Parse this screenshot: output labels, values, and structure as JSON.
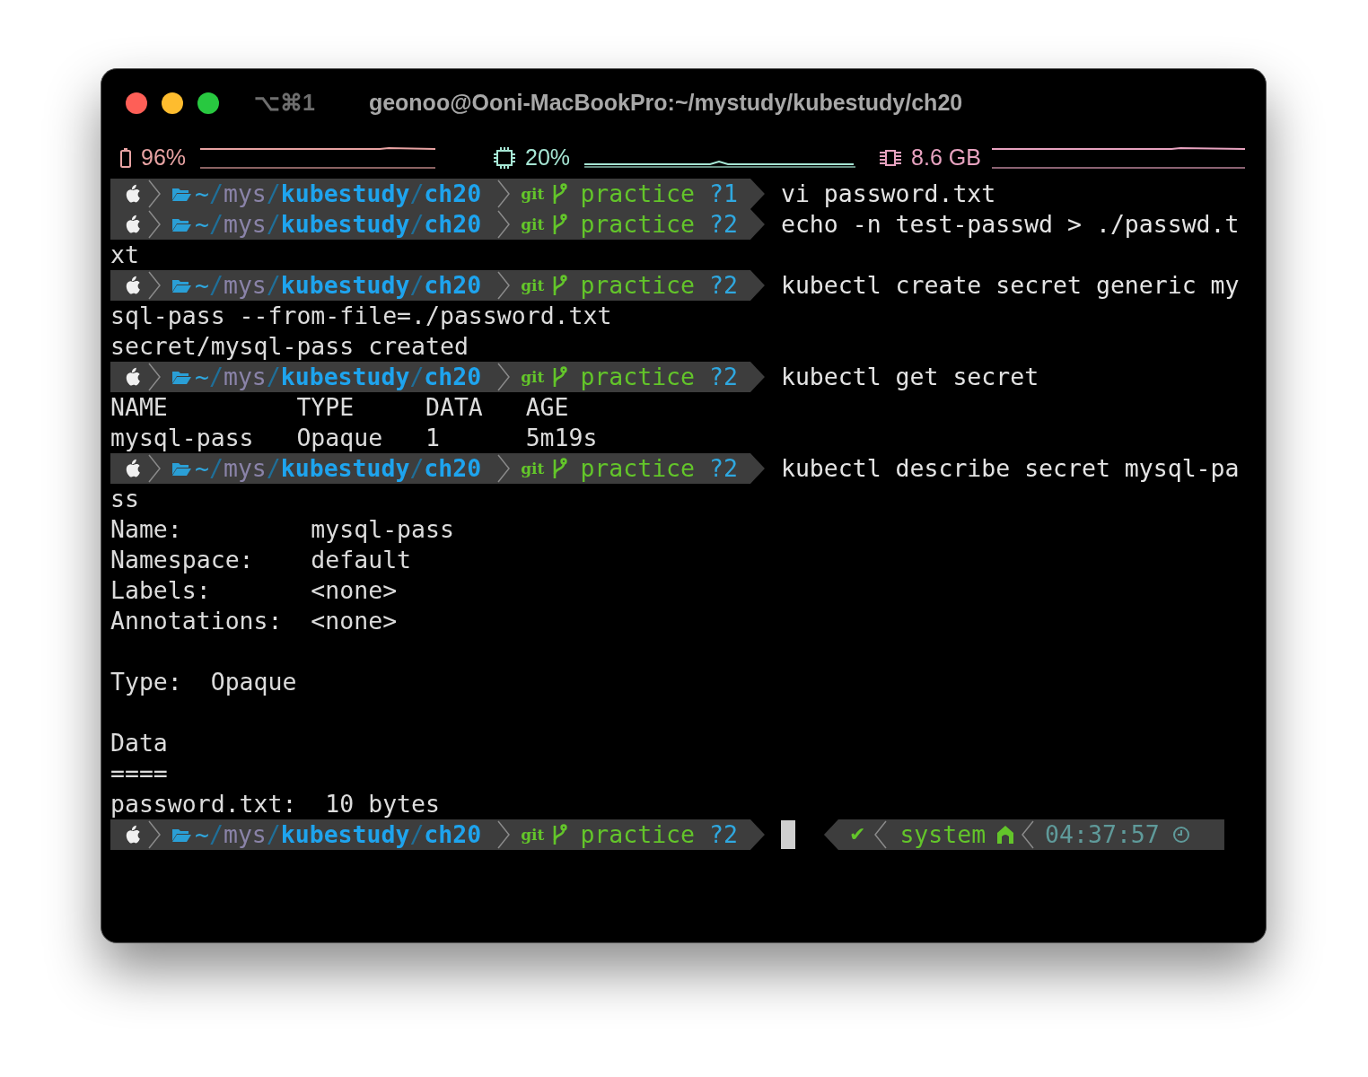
{
  "window": {
    "shortcut": "⌥⌘1",
    "title": "geonoo@Ooni-MacBookPro:~/mystudy/kubestudy/ch20"
  },
  "status_bar": [
    {
      "kind": "battery",
      "value": "96%",
      "color": "#e8a3a3"
    },
    {
      "kind": "cpu",
      "value": "20%",
      "color": "#a6e6d4"
    },
    {
      "kind": "memory",
      "value": "8.6 GB",
      "color": "#e8a3c0"
    }
  ],
  "lines": [
    {
      "kind": "prompt",
      "path": [
        "~",
        "/",
        "mys",
        "/",
        "kubestudy",
        "/",
        "ch20"
      ],
      "vcs": "git",
      "branch": "practice",
      "changes": "?1",
      "command": "vi password.txt"
    },
    {
      "kind": "prompt",
      "path": [
        "~",
        "/",
        "mys",
        "/",
        "kubestudy",
        "/",
        "ch20"
      ],
      "vcs": "git",
      "branch": "practice",
      "changes": "?2",
      "command": "echo -n test-passwd > ./passwd.t"
    },
    {
      "kind": "text",
      "text": "xt"
    },
    {
      "kind": "prompt",
      "path": [
        "~",
        "/",
        "mys",
        "/",
        "kubestudy",
        "/",
        "ch20"
      ],
      "vcs": "git",
      "branch": "practice",
      "changes": "?2",
      "command": "kubectl create secret generic my"
    },
    {
      "kind": "text",
      "text": "sql-pass --from-file=./password.txt"
    },
    {
      "kind": "text",
      "text": "secret/mysql-pass created"
    },
    {
      "kind": "prompt",
      "path": [
        "~",
        "/",
        "mys",
        "/",
        "kubestudy",
        "/",
        "ch20"
      ],
      "vcs": "git",
      "branch": "practice",
      "changes": "?2",
      "command": "kubectl get secret"
    },
    {
      "kind": "table",
      "columns": [
        "NAME",
        "TYPE",
        "DATA",
        "AGE"
      ],
      "rows": [
        [
          "mysql-pass",
          "Opaque",
          "1",
          "5m19s"
        ]
      ]
    },
    {
      "kind": "prompt",
      "path": [
        "~",
        "/",
        "mys",
        "/",
        "kubestudy",
        "/",
        "ch20"
      ],
      "vcs": "git",
      "branch": "practice",
      "changes": "?2",
      "command": "kubectl describe secret mysql-pa"
    },
    {
      "kind": "text",
      "text": "ss"
    },
    {
      "kind": "fields",
      "rows": [
        {
          "label": "Name:",
          "value": "mysql-pass"
        },
        {
          "label": "Namespace:",
          "value": "default"
        },
        {
          "label": "Labels:",
          "value": "<none>"
        },
        {
          "label": "Annotations:",
          "value": "<none>"
        }
      ]
    },
    {
      "kind": "blank"
    },
    {
      "kind": "fields",
      "rows": [
        {
          "label": "Type:",
          "value": "Opaque"
        }
      ]
    },
    {
      "kind": "blank"
    },
    {
      "kind": "text",
      "text": "Data"
    },
    {
      "kind": "text",
      "text": "===="
    },
    {
      "kind": "fields",
      "rows": [
        {
          "label": "password.txt:",
          "value": "10 bytes"
        }
      ]
    },
    {
      "kind": "prompt",
      "path": [
        "~",
        "/",
        "mys",
        "/",
        "kubestudy",
        "/",
        "ch20"
      ],
      "vcs": "git",
      "branch": "practice",
      "changes": "?2",
      "cursor": true,
      "right_prompt": {
        "status": "✔",
        "context": "system",
        "time": "04:37:57"
      }
    }
  ]
}
